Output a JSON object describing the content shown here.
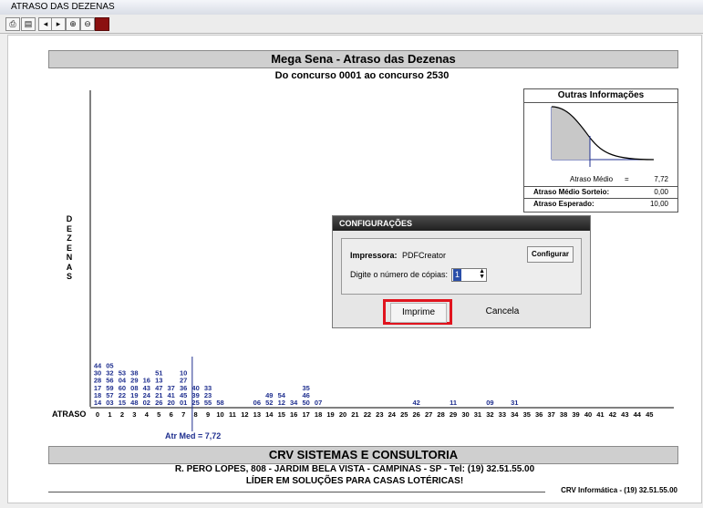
{
  "window": {
    "title": "ATRASO DAS DEZENAS"
  },
  "toolbar": {
    "icons": [
      "print-icon",
      "print-setup-icon",
      "prev-page-icon",
      "next-page-icon",
      "zoom-in-icon",
      "zoom-out-icon",
      "exit-icon"
    ]
  },
  "report": {
    "title": "Mega Sena - Atraso das Dezenas",
    "subtitle": "Do concurso 0001 ao concurso 2530",
    "y_axis_label": "DEZENAS",
    "x_axis_label": "ATRASO",
    "mean_label": "Atr Med = 7,72",
    "company": "CRV SISTEMAS E CONSULTORIA",
    "address": "R. PERO LOPES, 808 - JARDIM BELA VISTA - CAMPINAS - SP - Tel: (19) 32.51.55.00",
    "slogan": "LÍDER  EM  SOLUÇÕES  PARA  CASAS  LOTÉRICAS!",
    "footer": "CRV Informática - (19) 32.51.55.00"
  },
  "info": {
    "title": "Outras Informações",
    "mean_label": "Atraso Médio",
    "mean_eq": "=",
    "mean_value": "7,72",
    "sorteio_label": "Atraso Médio Sorteio:",
    "sorteio_value": "0,00",
    "esperado_label": "Atraso Esperado:",
    "esperado_value": "10,00"
  },
  "dialog": {
    "title": "CONFIGURAÇÕES",
    "printer_label": "Impressora:",
    "printer_value": "PDFCreator",
    "configure_button": "Configurar",
    "copies_label": "Digite o número de cópias:",
    "copies_value": "1",
    "print_button": "Imprime",
    "cancel_button": "Cancela"
  },
  "chart_data": {
    "type": "table",
    "x_label": "ATRASO",
    "y_label": "DEZENAS",
    "x_ticks": [
      0,
      1,
      2,
      3,
      4,
      5,
      6,
      7,
      8,
      9,
      10,
      11,
      12,
      13,
      14,
      15,
      16,
      17,
      18,
      19,
      20,
      21,
      22,
      23,
      24,
      25,
      26,
      27,
      28,
      29,
      30,
      31,
      32,
      33,
      34,
      35,
      36,
      37,
      38,
      39,
      40,
      41,
      42,
      43,
      44,
      45
    ],
    "mean": 7.72,
    "columns": [
      {
        "atraso": 0,
        "dezenas": [
          "14",
          "18",
          "17",
          "28",
          "30",
          "44"
        ]
      },
      {
        "atraso": 1,
        "dezenas": [
          "03",
          "57",
          "59",
          "56",
          "32",
          "05"
        ]
      },
      {
        "atraso": 2,
        "dezenas": [
          "15",
          "22",
          "60",
          "04",
          "53"
        ]
      },
      {
        "atraso": 3,
        "dezenas": [
          "48",
          "19",
          "08",
          "29",
          "38"
        ]
      },
      {
        "atraso": 4,
        "dezenas": [
          "02",
          "24",
          "43",
          "16"
        ]
      },
      {
        "atraso": 5,
        "dezenas": [
          "26",
          "21",
          "47",
          "13",
          "51"
        ]
      },
      {
        "atraso": 6,
        "dezenas": [
          "20",
          "41",
          "37"
        ]
      },
      {
        "atraso": 7,
        "dezenas": [
          "01",
          "45",
          "36",
          "27",
          "10"
        ]
      },
      {
        "atraso": 8,
        "dezenas": [
          "25",
          "39",
          "40"
        ]
      },
      {
        "atraso": 9,
        "dezenas": [
          "55",
          "23",
          "33"
        ]
      },
      {
        "atraso": 10,
        "dezenas": [
          "58"
        ]
      },
      {
        "atraso": 13,
        "dezenas": [
          "06"
        ]
      },
      {
        "atraso": 14,
        "dezenas": [
          "52",
          "49"
        ]
      },
      {
        "atraso": 15,
        "dezenas": [
          "12",
          "54"
        ]
      },
      {
        "atraso": 16,
        "dezenas": [
          "34"
        ]
      },
      {
        "atraso": 17,
        "dezenas": [
          "50",
          "46",
          "35"
        ]
      },
      {
        "atraso": 18,
        "dezenas": [
          "07"
        ]
      },
      {
        "atraso": 26,
        "dezenas": [
          "42"
        ]
      },
      {
        "atraso": 29,
        "dezenas": [
          "11"
        ]
      },
      {
        "atraso": 32,
        "dezenas": [
          "09"
        ]
      },
      {
        "atraso": 34,
        "dezenas": [
          "31"
        ]
      }
    ],
    "density_curve": {
      "type": "area",
      "title": "Outras Informações"
    }
  },
  "colors": {
    "number_blue": "#1f2f8f",
    "highlight_red": "#e0141e",
    "band_gray": "#cfcfcf"
  }
}
